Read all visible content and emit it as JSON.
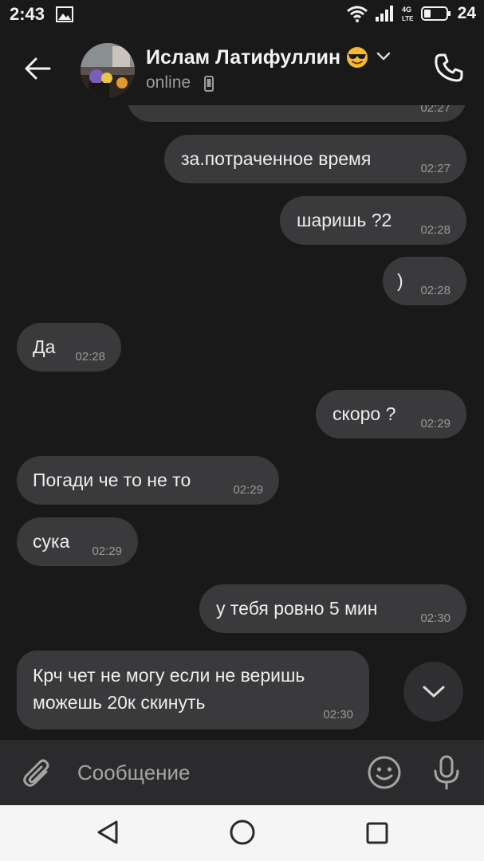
{
  "status_bar": {
    "time": "2:43",
    "battery_level": "24",
    "network": "4G LTE"
  },
  "header": {
    "contact_name": "Ислам Латифуллин",
    "status": "online",
    "icons": [
      "back-arrow-icon",
      "sunglasses-emoji-icon",
      "chevron-down-icon",
      "phone-icon",
      "mobile-device-icon"
    ]
  },
  "messages": [
    {
      "dir": "out",
      "text": "",
      "time": "02:27",
      "partial": true
    },
    {
      "dir": "out",
      "text": "за.потраченное время",
      "time": "02:27"
    },
    {
      "dir": "out",
      "text": "шаришь ?2",
      "time": "02:28"
    },
    {
      "dir": "out",
      "text": ")",
      "time": "02:28"
    },
    {
      "dir": "in",
      "text": "Да",
      "time": "02:28"
    },
    {
      "dir": "out",
      "text": "скоро ?",
      "time": "02:29"
    },
    {
      "dir": "in",
      "text": "Погади че то не то",
      "time": "02:29"
    },
    {
      "dir": "in",
      "text": "сука",
      "time": "02:29"
    },
    {
      "dir": "out",
      "text": "у тебя ровно 5 мин",
      "time": "02:30"
    },
    {
      "dir": "in",
      "text_line1": "Крч чет не могу если не веришь",
      "text_line2": "можешь 20к скинуть",
      "time": "02:30"
    }
  ],
  "composer": {
    "placeholder": "Сообщение",
    "icons": [
      "paperclip-icon",
      "smiley-icon",
      "microphone-icon"
    ]
  },
  "nav": {
    "icons": [
      "nav-back-icon",
      "nav-home-icon",
      "nav-recent-icon"
    ]
  },
  "colors": {
    "background": "#19191a",
    "bubble": "#3a3a3c",
    "input_bar": "#2b2b2d",
    "nav_bar": "#f5f5f5"
  }
}
